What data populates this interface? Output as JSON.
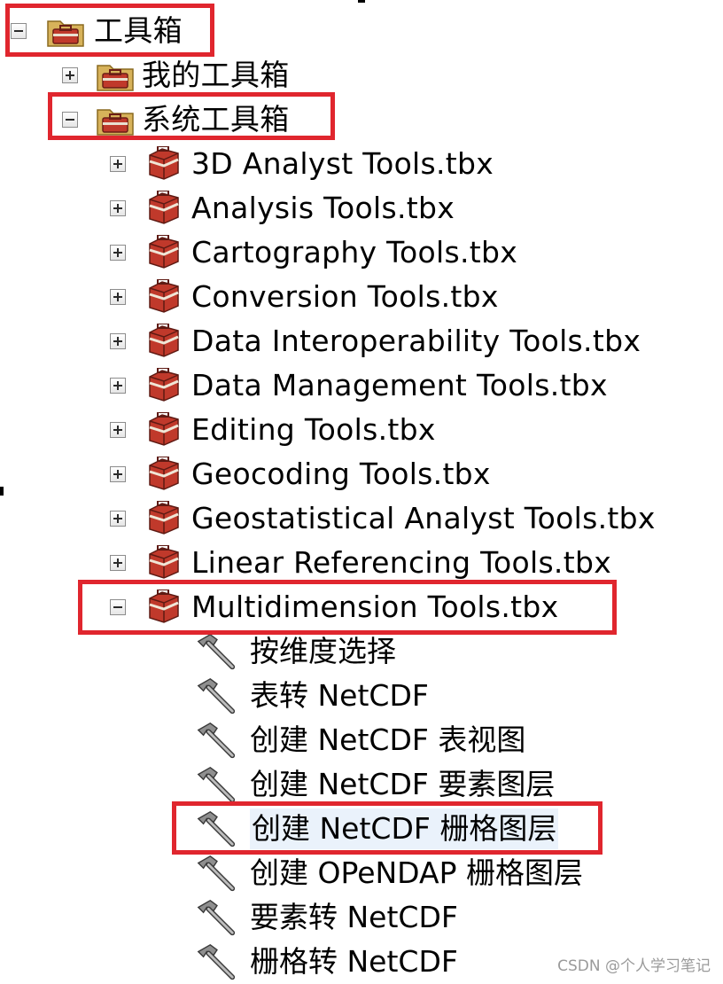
{
  "tree": {
    "root": {
      "label": "工具箱",
      "icon": "folder-toolbox-icon",
      "expanded": true
    },
    "my_toolboxes": {
      "label": "我的工具箱",
      "icon": "folder-toolbox-icon",
      "expanded": false
    },
    "system_toolboxes": {
      "label": "系统工具箱",
      "icon": "folder-toolbox-icon",
      "expanded": true
    },
    "toolboxes": [
      {
        "label": "3D Analyst Tools.tbx",
        "expanded": false,
        "icon": "toolbox-icon"
      },
      {
        "label": "Analysis Tools.tbx",
        "expanded": false,
        "icon": "toolbox-icon"
      },
      {
        "label": "Cartography Tools.tbx",
        "expanded": false,
        "icon": "toolbox-icon"
      },
      {
        "label": "Conversion Tools.tbx",
        "expanded": false,
        "icon": "toolbox-icon"
      },
      {
        "label": "Data Interoperability Tools.tbx",
        "expanded": false,
        "icon": "toolbox-icon"
      },
      {
        "label": "Data Management Tools.tbx",
        "expanded": false,
        "icon": "toolbox-icon"
      },
      {
        "label": "Editing Tools.tbx",
        "expanded": false,
        "icon": "toolbox-icon"
      },
      {
        "label": "Geocoding Tools.tbx",
        "expanded": false,
        "icon": "toolbox-icon"
      },
      {
        "label": "Geostatistical Analyst Tools.tbx",
        "expanded": false,
        "icon": "toolbox-icon"
      },
      {
        "label": "Linear Referencing Tools.tbx",
        "expanded": false,
        "icon": "toolbox-icon"
      },
      {
        "label": "Multidimension Tools.tbx",
        "expanded": true,
        "icon": "toolbox-icon"
      }
    ],
    "tools": [
      {
        "label": "按维度选择",
        "icon": "hammer-icon"
      },
      {
        "label": "表转 NetCDF",
        "icon": "hammer-icon"
      },
      {
        "label": "创建 NetCDF 表视图",
        "icon": "hammer-icon"
      },
      {
        "label": "创建 NetCDF 要素图层",
        "icon": "hammer-icon"
      },
      {
        "label": "创建 NetCDF 栅格图层",
        "icon": "hammer-icon",
        "selected": true
      },
      {
        "label": "创建 OPeNDAP 栅格图层",
        "icon": "hammer-icon"
      },
      {
        "label": "要素转 NetCDF",
        "icon": "hammer-icon"
      },
      {
        "label": "栅格转 NetCDF",
        "icon": "hammer-icon"
      }
    ]
  },
  "annotation_color": "#e0262e",
  "watermark": "CSDN @个人学习笔记"
}
